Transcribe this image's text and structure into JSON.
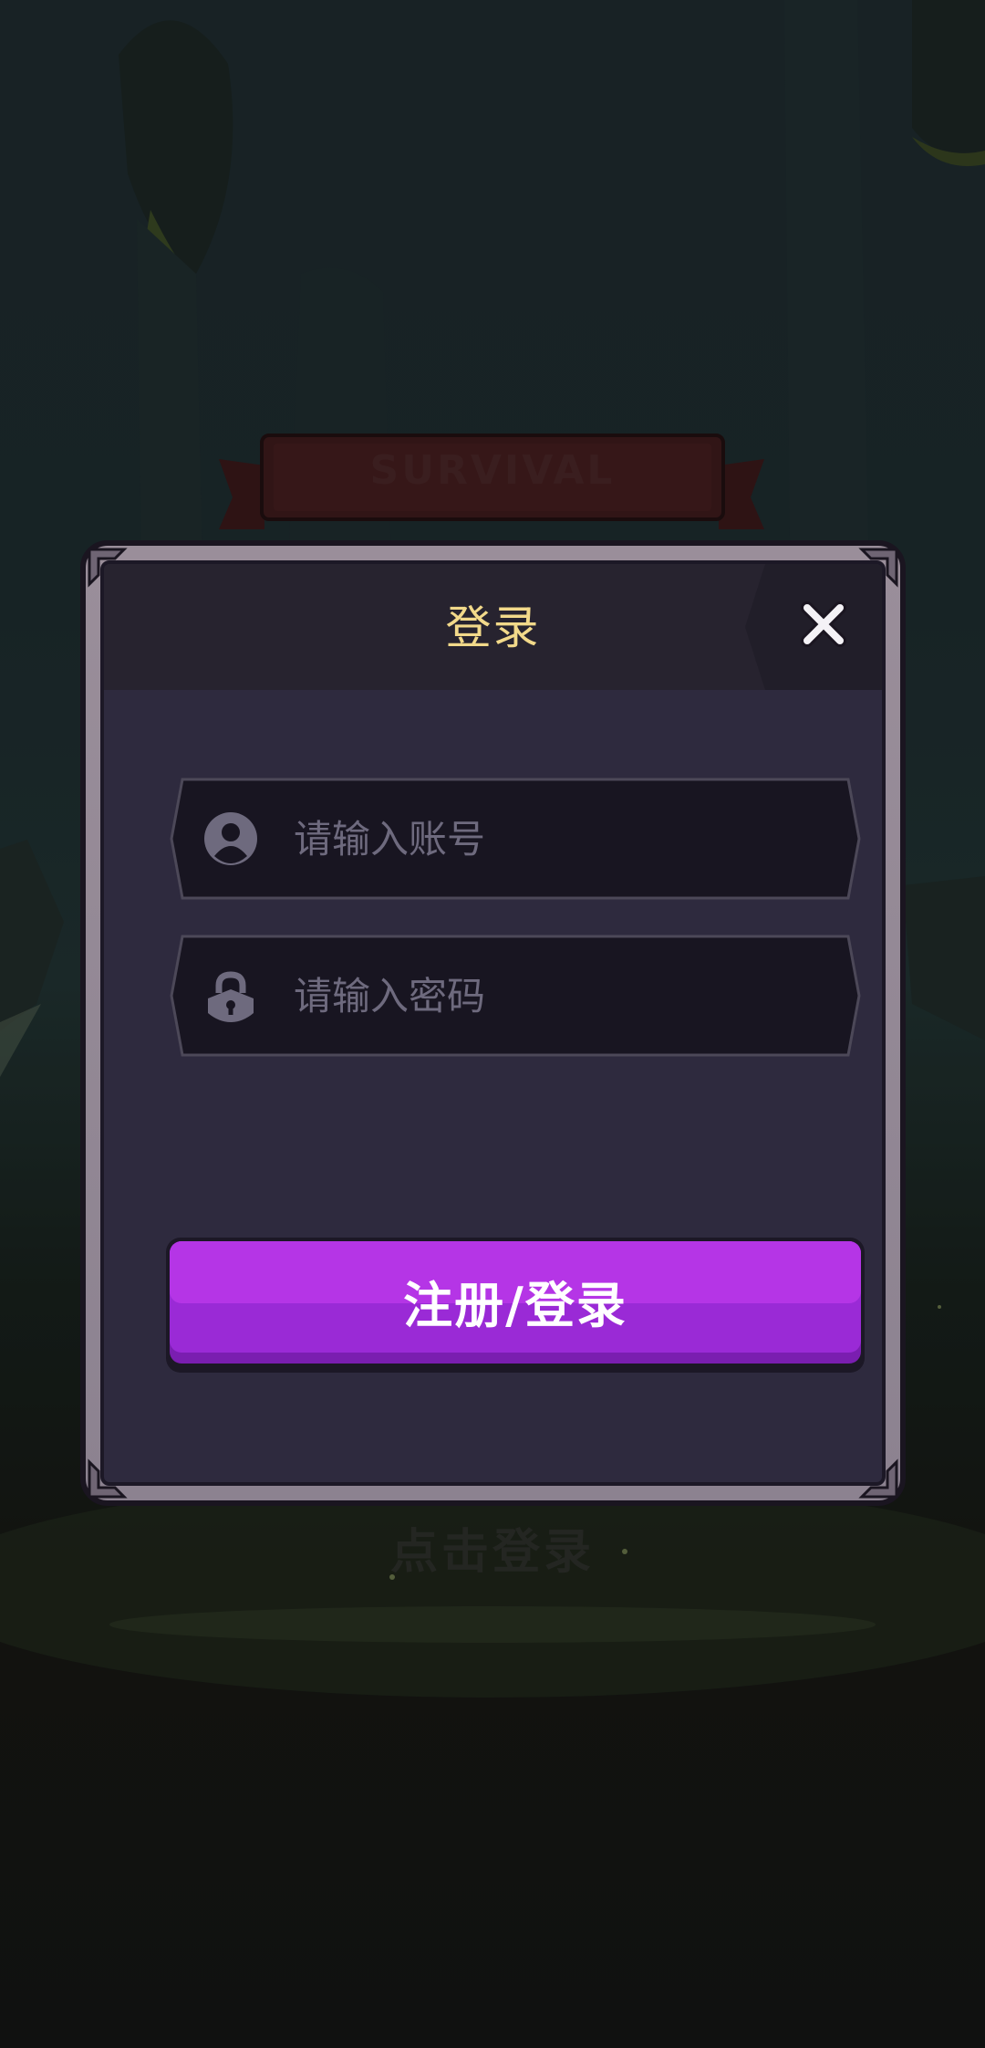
{
  "background": {
    "banner_text": "SURVIVAL",
    "tap_hint": "点击登录"
  },
  "dialog": {
    "title": "登录",
    "close_icon": "close-icon",
    "account_field": {
      "icon": "user-icon",
      "placeholder": "请输入账号",
      "value": ""
    },
    "password_field": {
      "icon": "lock-icon",
      "placeholder": "请输入密码",
      "value": ""
    },
    "submit_label": "注册/登录"
  },
  "colors": {
    "title_gold": "#f2d98a",
    "button_purple": "#a72fe0",
    "panel": "#2e2a3e",
    "frame": "#9a8e9a"
  }
}
